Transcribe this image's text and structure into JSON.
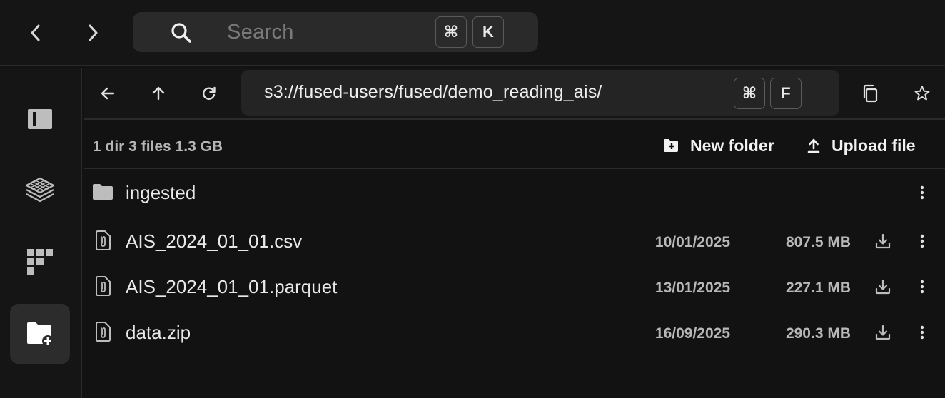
{
  "topbar": {
    "back_icon": "chevron-left-icon",
    "forward_icon": "chevron-right-icon",
    "search": {
      "placeholder": "Search",
      "shortcut_keys": [
        "⌘",
        "K"
      ]
    }
  },
  "sidebar": {
    "items": [
      {
        "icon": "panel-icon",
        "active": false
      },
      {
        "icon": "layers-icon",
        "active": false
      },
      {
        "icon": "blocks-icon",
        "active": false
      },
      {
        "icon": "folder-plus-icon",
        "active": true
      }
    ]
  },
  "pathbar": {
    "path": "s3://fused-users/fused/demo_reading_ais/",
    "shortcut_keys": [
      "⌘",
      "F"
    ],
    "icons": [
      "arrow-left-icon",
      "arrow-up-icon",
      "refresh-icon",
      "copy-icon",
      "star-icon"
    ]
  },
  "summary": {
    "text": "1 dir 3 files 1.3 GB",
    "new_folder_label": "New folder",
    "upload_file_label": "Upload file"
  },
  "files": [
    {
      "name": "ingested",
      "type": "folder",
      "date": "",
      "size": ""
    },
    {
      "name": "AIS_2024_01_01.csv",
      "type": "file",
      "date": "10/01/2025",
      "size": "807.5 MB"
    },
    {
      "name": "AIS_2024_01_01.parquet",
      "type": "file",
      "date": "13/01/2025",
      "size": "227.1 MB"
    },
    {
      "name": "data.zip",
      "type": "file",
      "date": "16/09/2025",
      "size": "290.3 MB"
    }
  ],
  "colors": {
    "background": "#121212",
    "panel": "#151515",
    "search_bg": "#2a2a2a",
    "active_sidebar": "#2c2c2c",
    "border": "#2b2b2b"
  }
}
